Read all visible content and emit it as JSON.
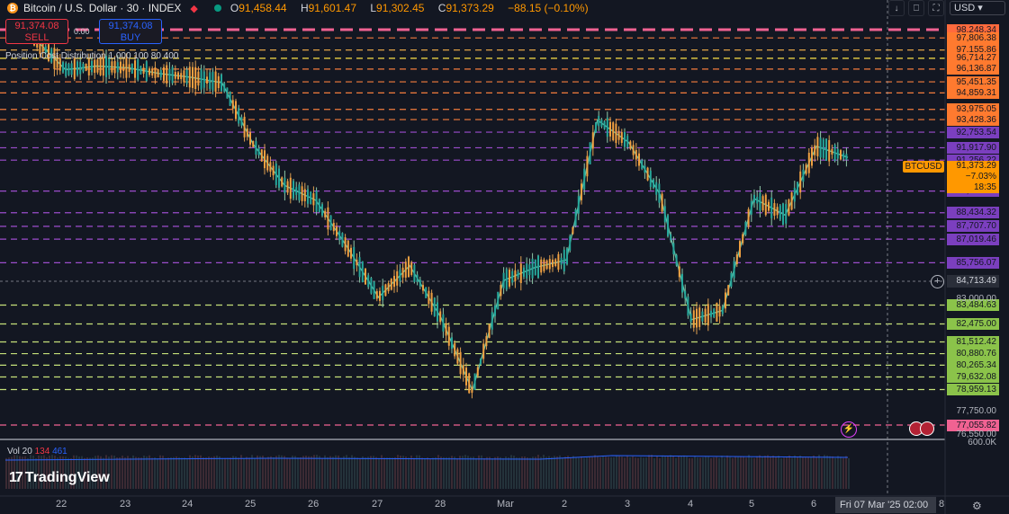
{
  "header": {
    "coin_symbol": "₿",
    "symbol": "Bitcoin / U.S. Dollar · 30 · INDEX",
    "ohlc": {
      "o": "91,458.44",
      "h": "91,601.47",
      "l": "91,302.45",
      "c": "91,373.29",
      "chg": "−88.15 (−0.10%)"
    },
    "currency": "USD",
    "icons": [
      "download-icon",
      "text-icon",
      "fullscreen-icon"
    ]
  },
  "trade": {
    "sell_price": "91,374.08",
    "sell_label": "SELL",
    "buy_price": "91,374.08",
    "buy_label": "BUY",
    "spread": "0.00"
  },
  "indicator": "Position Cost Distribution 1,000 100 80 400",
  "volume": {
    "label": "Vol 20",
    "v1": "134",
    "v2": "461",
    "v1_color": "#f23645",
    "v2_color": "#2962ff"
  },
  "logo": "TradingView",
  "x_ticks": [
    "22",
    "23",
    "24",
    "25",
    "26",
    "27",
    "28",
    "Mar",
    "2",
    "3",
    "4",
    "5",
    "6",
    "8"
  ],
  "crosshair_date": "Fri 07 Mar '25   02:00",
  "current": {
    "tag": "BTCUSD",
    "price": "91,373.29",
    "pct": "−7.03%",
    "countdown": "18:35",
    "color": "#ff9800"
  },
  "hover_price": "84,713.49",
  "plain_labels": [
    {
      "text": "83,000.00"
    },
    {
      "text": "77,750.00"
    },
    {
      "text": "76,550.00"
    },
    {
      "text": "600.0K"
    }
  ],
  "chart_data": {
    "type": "line",
    "title": "",
    "ylim": [
      76000,
      98500
    ],
    "x": [
      "Feb 21 12:00",
      "Feb 22 00:00",
      "Feb 22 12:00",
      "Feb 23 00:00",
      "Feb 23 12:00",
      "Feb 24 00:00",
      "Feb 24 12:00",
      "Feb 25 00:00",
      "Feb 25 12:00",
      "Feb 26 00:00",
      "Feb 26 12:00",
      "Feb 27 00:00",
      "Feb 27 12:00",
      "Feb 28 00:00",
      "Feb 28 12:00",
      "Mar 1 00:00",
      "Mar 1 12:00",
      "Mar 2 00:00",
      "Mar 2 12:00",
      "Mar 3 00:00",
      "Mar 3 12:00",
      "Mar 4 00:00",
      "Mar 4 12:00",
      "Mar 5 00:00",
      "Mar 5 12:00",
      "Mar 6 00:00",
      "Mar 6 12:00"
    ],
    "series": [
      {
        "values": [
          97800,
          96100,
          96300,
          96200,
          95900,
          95700,
          95400,
          92100,
          89900,
          89100,
          86600,
          83900,
          85600,
          82800,
          78900,
          84800,
          85500,
          85900,
          93400,
          92200,
          89400,
          82700,
          83200,
          89200,
          88300,
          92000,
          91400
        ]
      }
    ],
    "levels": [
      {
        "price": 98248.34,
        "text": "98,248.34",
        "color": "#ff6a3d",
        "line": "#f06292"
      },
      {
        "price": 97806.38,
        "text": "97,806.38",
        "color": "#ff7a2f",
        "line": "#f47c3c"
      },
      {
        "price": 97155.86,
        "text": "97,155.86",
        "color": "#ff7a2f",
        "line": "#f8b24a"
      },
      {
        "price": 96714.27,
        "text": "96,714.27",
        "color": "#ff7a2f",
        "line": "#fde047"
      },
      {
        "price": 96136.87,
        "text": "96,136.87",
        "color": "#ff7a2f",
        "line": "#f47c3c"
      },
      {
        "price": 95451.35,
        "text": "95,451.35",
        "color": "#ff7a2f",
        "line": "#f47c3c"
      },
      {
        "price": 94859.31,
        "text": "94,859.31",
        "color": "#ff7a2f",
        "line": "#f47c3c"
      },
      {
        "price": 93975.05,
        "text": "93,975.05",
        "color": "#ff7a2f",
        "line": "#f47c3c"
      },
      {
        "price": 93428.36,
        "text": "93,428.36",
        "color": "#ff7a2f",
        "line": "#f47c3c"
      },
      {
        "price": 92753.54,
        "text": "92,753.54",
        "color": "#7b3fbf",
        "line": "#9c4dcc"
      },
      {
        "price": 91917.9,
        "text": "91,917.90",
        "color": "#7b3fbf",
        "line": "#9c4dcc"
      },
      {
        "price": 91256.22,
        "text": "91,256.22",
        "color": "#7b3fbf",
        "line": "#9c4dcc"
      },
      {
        "price": 89597.55,
        "text": "89,597.55",
        "color": "#7b3fbf",
        "line": "#9c4dcc"
      },
      {
        "price": 88434.32,
        "text": "88,434.32",
        "color": "#7b3fbf",
        "line": "#9c4dcc"
      },
      {
        "price": 87707.7,
        "text": "87,707.70",
        "color": "#7b3fbf",
        "line": "#9c4dcc"
      },
      {
        "price": 87019.46,
        "text": "87,019.46",
        "color": "#7b3fbf",
        "line": "#9c4dcc"
      },
      {
        "price": 85756.07,
        "text": "85,756.07",
        "color": "#7b3fbf",
        "line": "#9c4dcc"
      },
      {
        "price": 83484.63,
        "text": "83,484.63",
        "color": "#8bc34a",
        "line": "#c5e17a"
      },
      {
        "price": 82475.0,
        "text": "82,475.00",
        "color": "#8bc34a",
        "line": "#c5e17a"
      },
      {
        "price": 81512.42,
        "text": "81,512.42",
        "color": "#8bc34a",
        "line": "#c5e17a"
      },
      {
        "price": 80880.76,
        "text": "80,880.76",
        "color": "#8bc34a",
        "line": "#c5e17a"
      },
      {
        "price": 80265.34,
        "text": "80,265.34",
        "color": "#8bc34a",
        "line": "#c5e17a"
      },
      {
        "price": 79632.08,
        "text": "79,632.08",
        "color": "#8bc34a",
        "line": "#c5e17a"
      },
      {
        "price": 78959.13,
        "text": "78,959.13",
        "color": "#8bc34a",
        "line": "#c5e17a"
      },
      {
        "price": 77055.82,
        "text": "77,055.82",
        "color": "#f06292",
        "line": "#f06292"
      }
    ],
    "last_price": 91373.29
  }
}
